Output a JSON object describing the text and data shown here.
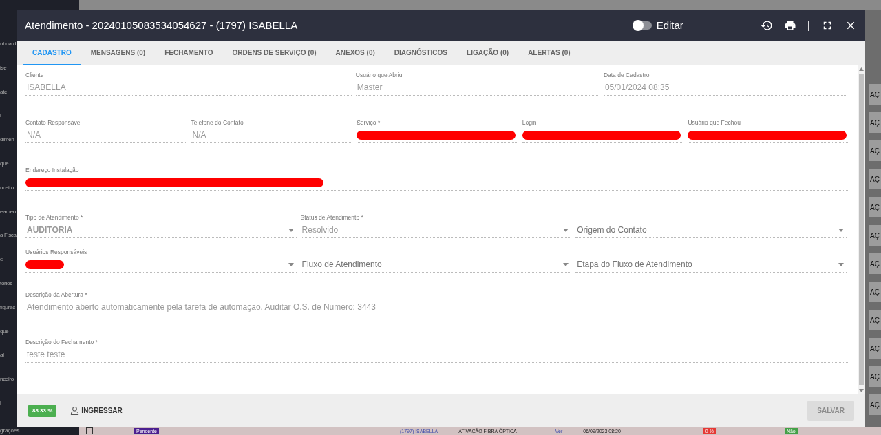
{
  "sidebar": {
    "items": [
      "nboard",
      "ise",
      "ate",
      "l",
      "dimen",
      "que",
      "nceiro",
      "eamen",
      "a Fisca",
      "e",
      "tórios",
      "figurac",
      "que",
      "al",
      "nceiro",
      "l"
    ]
  },
  "modal": {
    "title": "Atendimento - 20240105083534054627 - (1797) ISABELLA",
    "edit_toggle": {
      "label": "Editar",
      "on": false
    },
    "header_separator": "|",
    "tabs": [
      {
        "label": "CADASTRO",
        "selected": true
      },
      {
        "label": "MENSAGENS (0)",
        "selected": false
      },
      {
        "label": "FECHAMENTO",
        "selected": false
      },
      {
        "label": "ORDENS DE SERVIÇO (0)",
        "selected": false
      },
      {
        "label": "ANEXOS (0)",
        "selected": false
      },
      {
        "label": "DIAGNÓSTICOS",
        "selected": false
      },
      {
        "label": "LIGAÇÃO (0)",
        "selected": false
      },
      {
        "label": "ALERTAS (0)",
        "selected": false
      }
    ],
    "rows": [
      {
        "fields": [
          {
            "label": "Cliente",
            "value": "ISABELLA",
            "kind": "text"
          },
          {
            "label": "Usuário que Abriu",
            "value": "Master",
            "kind": "text"
          },
          {
            "label": "Data de Cadastro",
            "value": "05/01/2024 08:35",
            "kind": "text"
          }
        ]
      },
      {
        "fields": [
          {
            "label": "Contato Responsável",
            "value": "N/A",
            "kind": "text"
          },
          {
            "label": "Telefone do Contato",
            "value": "N/A",
            "kind": "text"
          },
          {
            "label": "Serviço *",
            "kind": "text",
            "redacted": true
          },
          {
            "label": "Login",
            "kind": "text",
            "redacted": true
          },
          {
            "label": "Usuário que Fechou",
            "kind": "text",
            "redacted": true
          }
        ]
      },
      {
        "fields": [
          {
            "label": "Endereço Instalação",
            "kind": "text",
            "redacted": true
          }
        ]
      },
      {
        "fields": [
          {
            "label": "Tipo de Atendimento *",
            "value": "AUDITORIA",
            "kind": "select",
            "strong": true
          },
          {
            "label": "Status de Atendimento *",
            "value": "Resolvido",
            "kind": "select"
          },
          {
            "placeholder": "Origem do Contato",
            "kind": "select"
          }
        ]
      },
      {
        "fields": [
          {
            "label": "Usuários Responsáveis",
            "kind": "select",
            "redacted": true
          },
          {
            "placeholder": "Fluxo de Atendimento",
            "kind": "select"
          },
          {
            "placeholder": "Etapa do Fluxo de Atendimento",
            "kind": "select"
          }
        ]
      },
      {
        "fields": [
          {
            "label": "Descrição da Abertura *",
            "value": "Atendimento aberto automaticamente pela tarefa de automação. Auditar O.S. de Numero: 3443",
            "kind": "text"
          }
        ]
      },
      {
        "fields": [
          {
            "label": "Descrição do Fechamento *",
            "value": "teste teste",
            "kind": "text"
          }
        ]
      }
    ],
    "footer": {
      "progress_badge": "88.33 %",
      "join_button": "INGRESSAR",
      "save_button": {
        "label": "SALVAR",
        "disabled": true
      }
    }
  },
  "side_actions": [
    "AÇ",
    "AÇ",
    "AÇ",
    "AÇ",
    "AÇ",
    "AÇ",
    "AÇ",
    "AÇ",
    "AÇ",
    "AÇ",
    "AÇ",
    "AÇ"
  ],
  "background_row": {
    "sidebar_item": "grações",
    "checked": false,
    "status": "Pendente",
    "client": "(1797) ISABELLA",
    "service": "ATIVAÇÃO FIBRA ÓPTICA",
    "link": "Ver",
    "date": "06/09/2023 08:20",
    "progress": "0 %",
    "answer": "Não"
  }
}
